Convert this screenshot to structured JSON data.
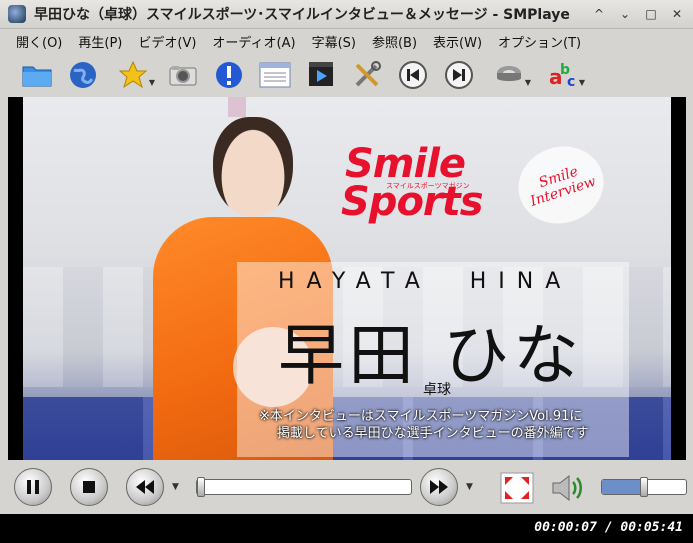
{
  "window": {
    "title": "早田ひな（卓球）スマイルスポーツ･スマイルインタビュー＆メッセージ - SMPlaye",
    "controls": [
      "^",
      "⌄",
      "□",
      "✕"
    ]
  },
  "menu": [
    "開く(O)",
    "再生(P)",
    "ビデオ(V)",
    "オーディオ(A)",
    "字幕(S)",
    "参照(B)",
    "表示(W)",
    "オプション(T)"
  ],
  "toolbar": {
    "icons": [
      "folder-icon",
      "globe-icon",
      "favorites-star-icon",
      "screenshot-camera-icon",
      "info-icon",
      "playlist-icon",
      "video-clip-icon",
      "preferences-tools-icon",
      "previous-icon",
      "next-icon",
      "audio-track-icon",
      "subtitles-icon"
    ]
  },
  "video": {
    "logo_line1": "Smile",
    "logo_line2": "Sports",
    "logo_sub": "スマイルスポーツマガジン",
    "badge": "Smile\nInterview",
    "romaji": "HAYATA  HINA",
    "name": "早田 ひな",
    "sport": "卓球",
    "note_line1": "※本インタビューはスマイルスポーツマガジンVol.91に",
    "note_line2": "掲載している早田ひな選手インタビューの番外編です"
  },
  "controls": {
    "seek_fraction": 0.02,
    "volume_fraction": 0.5
  },
  "status": {
    "time": "00:00:07 / 00:05:41"
  }
}
